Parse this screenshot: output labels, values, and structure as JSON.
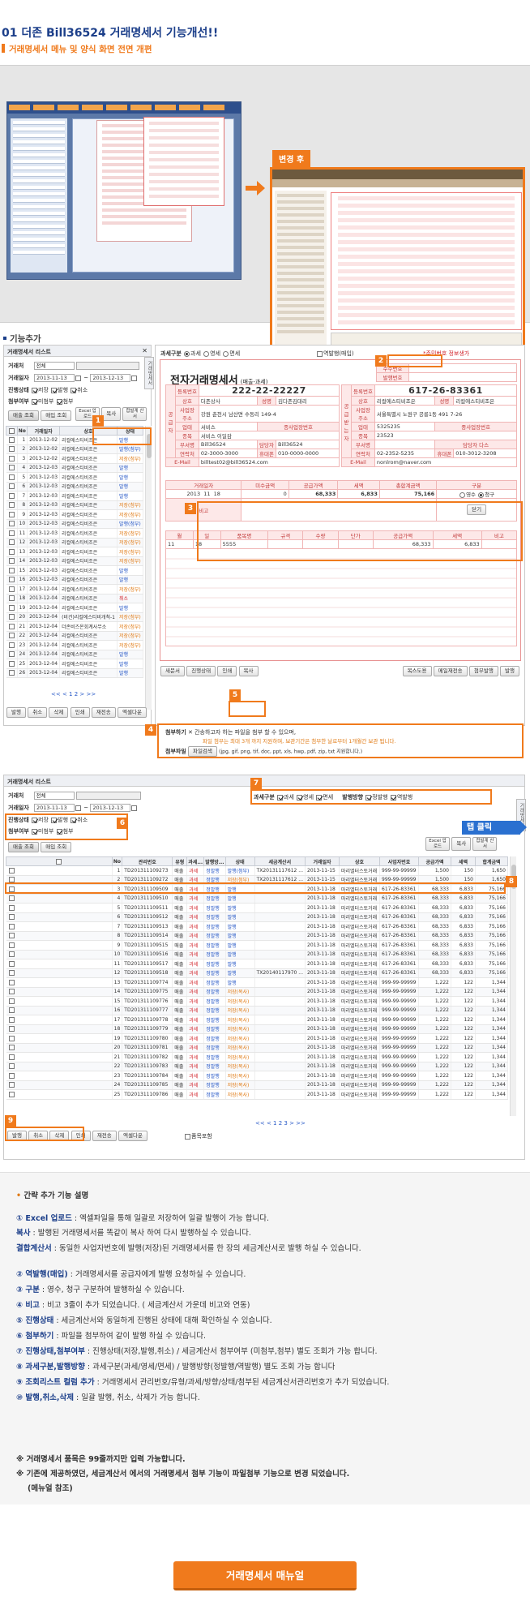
{
  "header": {
    "title": "01 더존 Bill36524 거래명세서 기능개선!!",
    "subtitle": "거래명세서 메뉴 및 양식 화면 전면 개편"
  },
  "hero": {
    "after_label": "변경 후"
  },
  "section2": {
    "title": "기능추가"
  },
  "list1": {
    "title": "거래명세서 리스트",
    "filter": {
      "type_label": "거래처",
      "type_value": "전체",
      "date_label": "거래일자",
      "date_from": "2013-11-13",
      "date_to": "2013-12-13",
      "status_label": "진행상태",
      "status_opts": [
        "저장",
        "발행",
        "취소"
      ],
      "attach_label": "첨부여부",
      "attach_opts": [
        "미첨부",
        "첨부"
      ]
    },
    "tabs": [
      "매출 조회",
      "매입 조회"
    ],
    "buttons": [
      "Excel 업로드",
      "복사",
      "합발계 산서"
    ],
    "columns": [
      "No",
      "거래일자",
      "상호",
      "상태"
    ],
    "rows": [
      [
        "1",
        "2013-12-02",
        "리컬에스티비조은",
        "발행"
      ],
      [
        "2",
        "2013-12-02",
        "리컬에스티비조은",
        "발행(첨부)"
      ],
      [
        "3",
        "2013-12-02",
        "리컬에스티비조은",
        "저장(첨부)"
      ],
      [
        "4",
        "2013-12-03",
        "리컬에스티비조은",
        "발행"
      ],
      [
        "5",
        "2013-12-03",
        "리컬에스티비조은",
        "발행"
      ],
      [
        "6",
        "2013-12-03",
        "리컬에스티비조은",
        "발행"
      ],
      [
        "7",
        "2013-12-03",
        "리컬에스티비조은",
        "발행"
      ],
      [
        "8",
        "2013-12-03",
        "리컬에스티비조은",
        "저장(첨부)"
      ],
      [
        "9",
        "2013-12-03",
        "리컬에스티비조은",
        "저장(첨부)"
      ],
      [
        "10",
        "2013-12-03",
        "리컬에스티비조은",
        "발행(첨부)"
      ],
      [
        "11",
        "2013-12-03",
        "리컬에스티비조은",
        "저장(첨부)"
      ],
      [
        "12",
        "2013-12-03",
        "리컬에스티비조은",
        "저장(첨부)"
      ],
      [
        "13",
        "2013-12-03",
        "리컬에스티비조은",
        "저장(첨부)"
      ],
      [
        "14",
        "2013-12-03",
        "리컬에스티비조은",
        "저장(첨부)"
      ],
      [
        "15",
        "2013-12-03",
        "리컬에스티비조은",
        "발행"
      ],
      [
        "16",
        "2013-12-03",
        "리컬에스티비조은",
        "발행"
      ],
      [
        "17",
        "2013-12-04",
        "리컬에스티비조은",
        "저장(첨부)"
      ],
      [
        "18",
        "2013-12-04",
        "리컬에스티비조은",
        "취소"
      ],
      [
        "19",
        "2013-12-04",
        "리컬에스티비조은",
        "발행"
      ],
      [
        "20",
        "2013-12-04",
        "(비건)리컬에스티비개척-1",
        "저장(첨부)"
      ],
      [
        "21",
        "2013-12-04",
        "더존비즈온회계사무소",
        "저장(첨부)"
      ],
      [
        "22",
        "2013-12-04",
        "리컬에스티비조은",
        "저장(첨부)"
      ],
      [
        "23",
        "2013-12-04",
        "리컬에스티비조은",
        "저장(첨부)"
      ],
      [
        "24",
        "2013-12-04",
        "리컬에스티비조은",
        "발행"
      ],
      [
        "25",
        "2013-12-04",
        "리컬에스티비조은",
        "발행"
      ],
      [
        "26",
        "2013-12-04",
        "리컬에스티비조은",
        "발행"
      ]
    ],
    "pager": "<< < 1 2 > >>",
    "bottom_buttons": [
      "발행",
      "취소",
      "삭제",
      "인쇄",
      "재전송",
      "엑셀다운"
    ]
  },
  "invoice": {
    "tax_label": "과세구분",
    "tax_opts": [
      "과세",
      "영세",
      "면세"
    ],
    "reverse_label": "역발행(매입)",
    "reverse_note": "*주민번호 정보생가",
    "title": "전자거래명세서",
    "title_sub": "(매출-과세)",
    "supplier_bizno": "222-22-22227",
    "buyer_bizno": "617-26-83361",
    "supplier": {
      "name_label": "상호",
      "name": "더존상사",
      "ceo_label": "성명",
      "ceo": "김다존김대리",
      "addr": "강원 춘천시 남산면 수동리 149-4",
      "type": "서비스",
      "item": "서비스 이일감",
      "manager": "Bill36524",
      "phone": "02-3000-3000",
      "mobile": "010-0000-0000",
      "email": "billtest02@bill36524.com"
    },
    "buyer": {
      "name": "리컬에스티비조은",
      "ceo": "리컬에스티비조은",
      "addr": "서울특별시 노원구 공릉1동 491 7-26",
      "type": "5325235",
      "item": "23523",
      "manager": "담당자 다스",
      "phone": "02-2352-5235",
      "mobile": "010-3012-3208",
      "email": "nonlrom@naver.com",
      "biz_reg_label": "중사업장번호"
    },
    "sum_cols": [
      "거래일자",
      "미수금액",
      "공급가액",
      "세액",
      "총합계금액",
      "구분"
    ],
    "sum_values": [
      "2013",
      "11",
      "18",
      "0",
      "68,333",
      "6,833",
      "75,166"
    ],
    "kind_opts": [
      "영수",
      "청구"
    ],
    "remark_label": "비고",
    "close_label": "닫기",
    "item_cols": [
      "월",
      "일",
      "품목명",
      "규격",
      "수량",
      "단가",
      "공급가액",
      "세액",
      "비고"
    ],
    "item_row": [
      "11",
      "18",
      "5555",
      "",
      "",
      "",
      "68,333",
      "6,833",
      ""
    ],
    "btns_left": [
      "새문서",
      "진행상태",
      "인쇄",
      "복사"
    ],
    "btns_right": [
      "복스도용",
      "메일재전송",
      "첨부발행",
      "발행"
    ],
    "attach_label": "첨부하기",
    "attach_note1": "✕ 간송하고자 하는 파일을 첨부 할 수 있으며,",
    "attach_note2": "파일 첨부는 최대 3개 까지 지원하며, 보관기간은 첨부한 날로부터 1개월간 보관 됩니다.",
    "attach_file_label": "첨부파일",
    "attach_btn": "파일검색",
    "attach_ext": "(jpg, gif, png, tif, doc, ppt, xls, hwp, pdf, zip, txt 지원합니다.)"
  },
  "list2": {
    "title": "거래명세서 리스트",
    "tax_label": "과세구분",
    "tax_opts": [
      "과세",
      "영세",
      "면세"
    ],
    "issue_label": "발행방향",
    "issue_opts": [
      "정발행",
      "역발행"
    ],
    "tab_click": "탭 클릭",
    "columns": [
      "No",
      "관리번호",
      "유형",
      "과세...",
      "발행방...",
      "상태",
      "세금계산서",
      "거래일자",
      "상호",
      "사업자번호",
      "공급가액",
      "세액",
      "합계금액"
    ],
    "rows": [
      [
        "1",
        "TD201311109273",
        "매출",
        "과세",
        "정발행",
        "발행(첨부)",
        "TX20131117612 ...",
        "2013-11-15",
        "마리엘터스토거래",
        "999-99-99999",
        "1,500",
        "150",
        "1,650"
      ],
      [
        "2",
        "TD201311109272",
        "매출",
        "과세",
        "정발행",
        "저장(첨부)",
        "TX20131117612 ...",
        "2013-11-15",
        "마리엘터스토거래",
        "999-99-99999",
        "1,500",
        "150",
        "1,650"
      ],
      [
        "3",
        "TD201311109509",
        "매출",
        "과세",
        "정발행",
        "발행",
        "",
        "2013-11-18",
        "마리엘터스토거래",
        "617-26-83361",
        "68,333",
        "6,833",
        "75,166"
      ],
      [
        "4",
        "TD201311109510",
        "매출",
        "과세",
        "정발행",
        "발행",
        "",
        "2013-11-18",
        "마리엘터스토거래",
        "617-26-83361",
        "68,333",
        "6,833",
        "75,166"
      ],
      [
        "5",
        "TD201311109511",
        "매출",
        "과세",
        "정발행",
        "발행",
        "",
        "2013-11-18",
        "마리엘터스토거래",
        "617-26-83361",
        "68,333",
        "6,833",
        "75,166"
      ],
      [
        "6",
        "TD201311109512",
        "매출",
        "과세",
        "정발행",
        "발행",
        "",
        "2013-11-18",
        "마리엘터스토거래",
        "617-26-83361",
        "68,333",
        "6,833",
        "75,166"
      ],
      [
        "7",
        "TD201311109513",
        "매출",
        "과세",
        "정발행",
        "발행",
        "",
        "2013-11-18",
        "마리엘터스토거래",
        "617-26-83361",
        "68,333",
        "6,833",
        "75,166"
      ],
      [
        "8",
        "TD201311109514",
        "매출",
        "과세",
        "정발행",
        "발행",
        "",
        "2013-11-18",
        "마리엘터스토거래",
        "617-26-83361",
        "68,333",
        "6,833",
        "75,166"
      ],
      [
        "9",
        "TD201311109515",
        "매출",
        "과세",
        "정발행",
        "발행",
        "",
        "2013-11-18",
        "마리엘터스토거래",
        "617-26-83361",
        "68,333",
        "6,833",
        "75,166"
      ],
      [
        "10",
        "TD201311109516",
        "매출",
        "과세",
        "정발행",
        "발행",
        "",
        "2013-11-18",
        "마리엘터스토거래",
        "617-26-83361",
        "68,333",
        "6,833",
        "75,166"
      ],
      [
        "11",
        "TD201311109517",
        "매출",
        "과세",
        "정발행",
        "발행",
        "",
        "2013-11-18",
        "마리엘터스토거래",
        "617-26-83361",
        "68,333",
        "6,833",
        "75,166"
      ],
      [
        "12",
        "TD201311109518",
        "매출",
        "과세",
        "정발행",
        "발행",
        "TX20140117970 ...",
        "2013-11-18",
        "마리엘터스토거래",
        "617-26-83361",
        "68,333",
        "6,833",
        "75,166"
      ],
      [
        "13",
        "TD201311109774",
        "매출",
        "과세",
        "정발행",
        "발행",
        "",
        "2013-11-18",
        "마리엘터스토거래",
        "999-99-99999",
        "1,222",
        "122",
        "1,344"
      ],
      [
        "14",
        "TD201311109775",
        "매출",
        "과세",
        "정발행",
        "저장(복사)",
        "",
        "2013-11-18",
        "마리엘터스토거래",
        "999-99-99999",
        "1,222",
        "122",
        "1,344"
      ],
      [
        "15",
        "TD201311109776",
        "매출",
        "과세",
        "정발행",
        "저장(복사)",
        "",
        "2013-11-18",
        "마리엘터스토거래",
        "999-99-99999",
        "1,222",
        "122",
        "1,344"
      ],
      [
        "16",
        "TD201311109777",
        "매출",
        "과세",
        "정발행",
        "저장(복사)",
        "",
        "2013-11-18",
        "마리엘터스토거래",
        "999-99-99999",
        "1,222",
        "122",
        "1,344"
      ],
      [
        "17",
        "TD201311109778",
        "매출",
        "과세",
        "정발행",
        "저장(복사)",
        "",
        "2013-11-18",
        "마리엘터스토거래",
        "999-99-99999",
        "1,222",
        "122",
        "1,344"
      ],
      [
        "18",
        "TD201311109779",
        "매출",
        "과세",
        "정발행",
        "저장(복사)",
        "",
        "2013-11-18",
        "마리엘터스토거래",
        "999-99-99999",
        "1,222",
        "122",
        "1,344"
      ],
      [
        "19",
        "TD201311109780",
        "매출",
        "과세",
        "정발행",
        "저장(복사)",
        "",
        "2013-11-18",
        "마리엘터스토거래",
        "999-99-99999",
        "1,222",
        "122",
        "1,344"
      ],
      [
        "20",
        "TD201311109781",
        "매출",
        "과세",
        "정발행",
        "저장(복사)",
        "",
        "2013-11-18",
        "마리엘터스토거래",
        "999-99-99999",
        "1,222",
        "122",
        "1,344"
      ],
      [
        "21",
        "TD201311109782",
        "매출",
        "과세",
        "정발행",
        "저장(복사)",
        "",
        "2013-11-18",
        "마리엘터스토거래",
        "999-99-99999",
        "1,222",
        "122",
        "1,344"
      ],
      [
        "22",
        "TD201311109783",
        "매출",
        "과세",
        "정발행",
        "저장(복사)",
        "",
        "2013-11-18",
        "마리엘터스토거래",
        "999-99-99999",
        "1,222",
        "122",
        "1,344"
      ],
      [
        "23",
        "TD201311109784",
        "매출",
        "과세",
        "정발행",
        "저장(복사)",
        "",
        "2013-11-18",
        "마리엘터스토거래",
        "999-99-99999",
        "1,222",
        "122",
        "1,344"
      ],
      [
        "24",
        "TD201311109785",
        "매출",
        "과세",
        "정발행",
        "저장(복사)",
        "",
        "2013-11-18",
        "마리엘터스토거래",
        "999-99-99999",
        "1,222",
        "122",
        "1,344"
      ],
      [
        "25",
        "TD201311109786",
        "매출",
        "과세",
        "정발행",
        "저장(복사)",
        "",
        "2013-11-18",
        "마리엘터스토거래",
        "999-99-99999",
        "1,222",
        "122",
        "1,344"
      ]
    ],
    "pager": "<< < 1 2 3 > >>",
    "bottom_buttons": [
      "발행",
      "취소",
      "삭제",
      "인쇄",
      "재전송",
      "엑셀다운"
    ],
    "item_sum": "품목포함"
  },
  "notes": {
    "title": "간략 추가 기능 설명",
    "lines": [
      [
        "① Excel 업로드",
        " : 엑셀파일을 통해 일괄로 저장하여 일괄 발행이 가능 합니다."
      ],
      [
        "    복사",
        " : 발행된 거래명세서를 똑같이 복사 하여 다시 발행하실 수 있습니다."
      ],
      [
        "    결합계산서",
        " : 동일한 사업자번호에 발행(저장)된 거래명세서를 한 장의 세금계산서로 발행 하실 수 있습니다."
      ],
      [
        "② 역발행(매입)",
        " : 거래명세서를 공급자에게 발행 요청하실 수 있습니다."
      ],
      [
        "③ 구분",
        " : 영수, 청구 구분하여 발행하실 수 있습니다."
      ],
      [
        "④ 비고",
        " : 비고 3줄이 추가 되었습니다. ( 세금계산서 가운데 비고와 연동)"
      ],
      [
        "⑤ 진행상태",
        " : 세금계산서와 동일하게 진행된 상태에 대해 확인하실 수 있습니다."
      ],
      [
        "⑥ 첨부하기",
        " : 파일을 첨부하여 같이 발행 하실 수 있습니다."
      ],
      [
        "⑦ 진행상태,첨부여부",
        " : 진행상태(저장,발행,취소) / 세금계산서 첨부여부 (미첨부,첨부) 별도 조회가 가능 합니다."
      ],
      [
        "⑧ 과세구분,발행방향",
        " : 과세구분(과세/영세/면세) / 발행방향(정발행/역발행) 별도 조회 가능 합니다"
      ],
      [
        "⑨ 조회리스트 컬럼 추가",
        " : 거래명세서 관리번호/유형/과세/방향/상태/첨부된 세금계산서관리번호가 추가 되었습니다."
      ],
      [
        "⑩ 발행,취소,삭제",
        " : 일괄 발행, 취소, 삭제가 가능 합니다."
      ]
    ],
    "foot1": "※ 거래명세서 품목은 99줄까지만 입력 가능합니다.",
    "foot2": "※ 기존에 제공하였던, 세금계산서 에서의 거래명세서 첨부 기능이 파일첨부 기능으로 변경 되었습니다.",
    "foot3": "(메뉴얼 참조)"
  },
  "manual_button": "거래명세서 매뉴얼",
  "marker_numbers": [
    "1",
    "2",
    "3",
    "4",
    "5",
    "6",
    "7",
    "8",
    "9"
  ]
}
